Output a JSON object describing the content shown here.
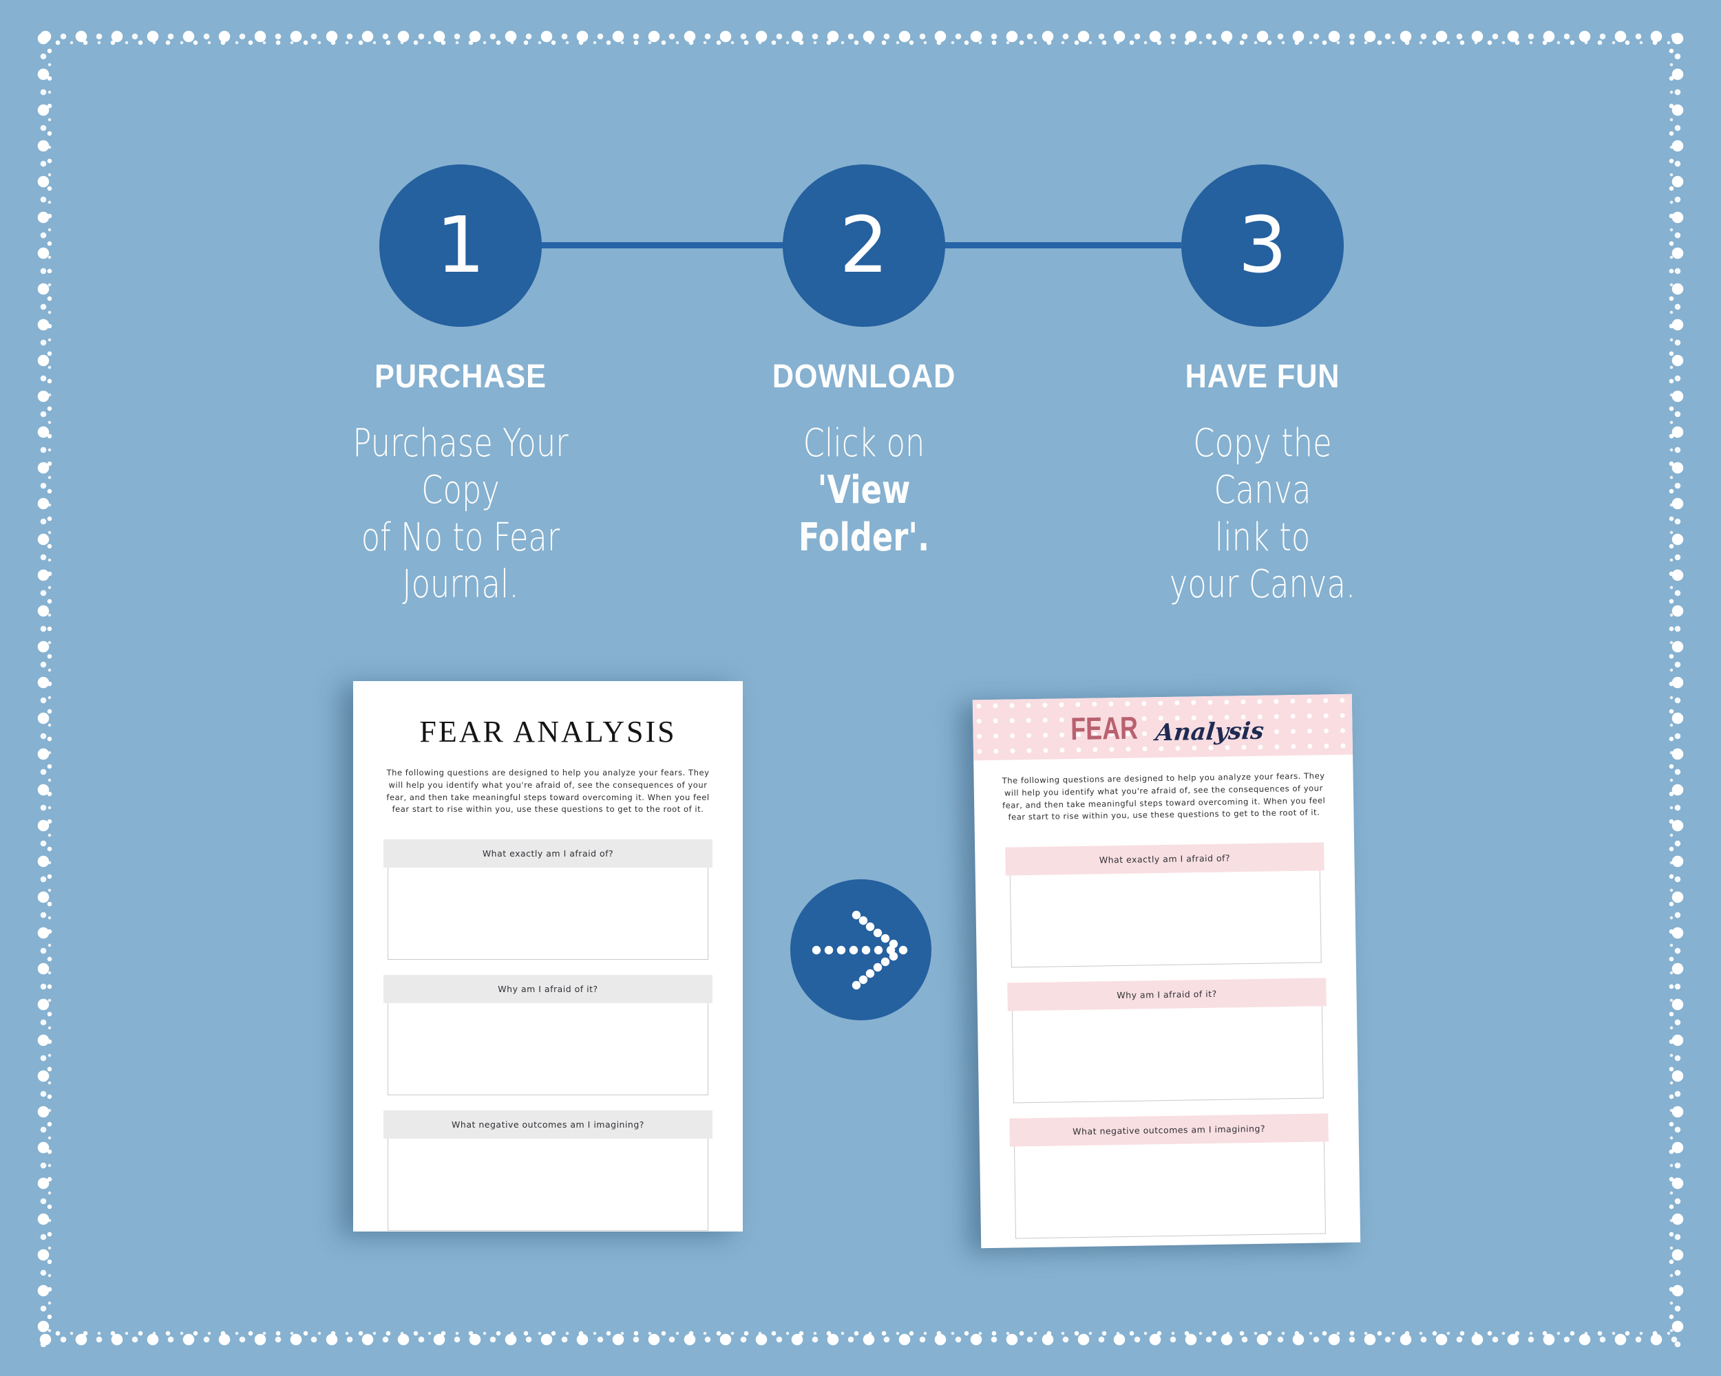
{
  "canvas": {
    "background_color": "#86b1d0",
    "accent_color": "#25609f",
    "pink_accent": "#f8dfe2",
    "rose_text": "#b9616f",
    "navy_script": "#1f2b52"
  },
  "steps": [
    {
      "number": "1",
      "title": "PURCHASE",
      "body_lines": [
        "Purchase Your Copy",
        "of No to Fear",
        "Journal."
      ],
      "bold_fragment": ""
    },
    {
      "number": "2",
      "title": "DOWNLOAD",
      "body_lines": [
        "Click  on",
        "'View Folder'."
      ],
      "bold_fragment": "'View Folder'"
    },
    {
      "number": "3",
      "title": "HAVE FUN",
      "body_lines": [
        "Copy the Canva",
        "link to",
        "your Canva."
      ],
      "bold_fragment": ""
    }
  ],
  "documents": {
    "before": {
      "title": "FEAR ANALYSIS",
      "intro": "The following questions are designed to help you analyze your fears. They will help you identify what you're afraid of, see the consequences of your fear, and then take meaningful steps toward overcoming it. When you feel fear start to rise within you, use these questions to get to the root of it.",
      "questions": [
        "What exactly am I afraid of?",
        "Why am I afraid of it?",
        "What negative outcomes am I imagining?"
      ]
    },
    "after": {
      "title_bold": "FEAR",
      "title_script": "Analysis",
      "intro": "The following questions are designed to help you analyze your fears. They will help you identify what you're afraid of, see the consequences of your fear, and then take meaningful steps toward overcoming it. When you feel fear start to rise within you, use these questions to get to the root of it.",
      "questions": [
        "What exactly am I afraid of?",
        "Why am I afraid of it?",
        "What negative outcomes am I imagining?"
      ]
    }
  },
  "transform_arrow": {
    "icon": "dotted-arrow-right-icon"
  }
}
